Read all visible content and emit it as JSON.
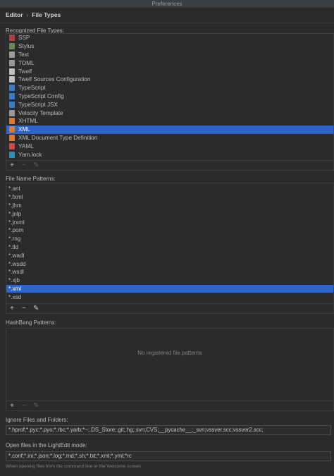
{
  "window": {
    "title": "Preferences"
  },
  "breadcrumb": {
    "parent": "Editor",
    "separator": "›",
    "current": "File Types"
  },
  "recognized": {
    "label": "Recognized File Types:",
    "items": [
      {
        "label": "SSP",
        "icon": "ssp-icon",
        "color": "#b04040"
      },
      {
        "label": "Stylus",
        "icon": "stylus-icon",
        "color": "#6a8759"
      },
      {
        "label": "Text",
        "icon": "text-file-icon",
        "color": "#9a9a9a"
      },
      {
        "label": "TOML",
        "icon": "toml-icon",
        "color": "#9a9a9a"
      },
      {
        "label": "Twelf",
        "icon": "twelf-icon",
        "color": "#c0c0c0"
      },
      {
        "label": "Twelf Sources Configuration",
        "icon": "twelf-config-icon",
        "color": "#c0c0c0"
      },
      {
        "label": "TypeScript",
        "icon": "typescript-icon",
        "color": "#3e7bc7"
      },
      {
        "label": "TypeScript Config",
        "icon": "typescript-config-icon",
        "color": "#3e7bc7"
      },
      {
        "label": "TypeScript JSX",
        "icon": "typescript-jsx-icon",
        "color": "#3e7bc7"
      },
      {
        "label": "Velocity Template",
        "icon": "velocity-icon",
        "color": "#9a9a9a"
      },
      {
        "label": "XHTML",
        "icon": "xhtml-icon",
        "color": "#e07a30"
      },
      {
        "label": "XML",
        "icon": "xml-icon",
        "color": "#e07a30",
        "selected": true
      },
      {
        "label": "XML Document Type Definition",
        "icon": "dtd-icon",
        "color": "#e07a30"
      },
      {
        "label": "YAML",
        "icon": "yaml-icon",
        "color": "#d04a4a"
      },
      {
        "label": "Yarn.lock",
        "icon": "yarn-icon",
        "color": "#2c8ebb"
      }
    ],
    "toolbar": {
      "add": "+",
      "remove": "−",
      "edit": "✎"
    }
  },
  "patterns": {
    "label": "File Name Patterns:",
    "items": [
      "*.ant",
      "*.fxml",
      "*.jhm",
      "*.jnlp",
      "*.jrxml",
      "*.pom",
      "*.rng",
      "*.tld",
      "*.wadl",
      "*.wsdd",
      "*.wsdl",
      "*.xjb",
      "*.xml",
      "*.xsd"
    ],
    "selected_index": 12,
    "toolbar": {
      "add": "+",
      "remove": "−",
      "edit": "✎"
    }
  },
  "hashbang": {
    "label": "HashBang Patterns:",
    "empty_text": "No registered file patterns",
    "toolbar": {
      "add": "+",
      "remove": "−",
      "edit": "✎"
    }
  },
  "ignore": {
    "label": "Ignore Files and Folders:",
    "value": "*.hprof;*.pyc;*.pyo;*.rbc;*.yarb;*~;.DS_Store;.git;.hg;.svn;CVS;__pycache__;_svn;vssver.scc;vssver2.scc;"
  },
  "lightedit": {
    "label": "Open files in the LightEdit mode:",
    "value": "*.conf;*.ini;*.json;*.log;*.md;*.sh;*.txt;*.xml;*.yml;*rc",
    "hint": "When opening files from the command line or the Welcome screen"
  },
  "colors": {
    "selection": "#2f65ca",
    "background": "#2b2b2b"
  }
}
